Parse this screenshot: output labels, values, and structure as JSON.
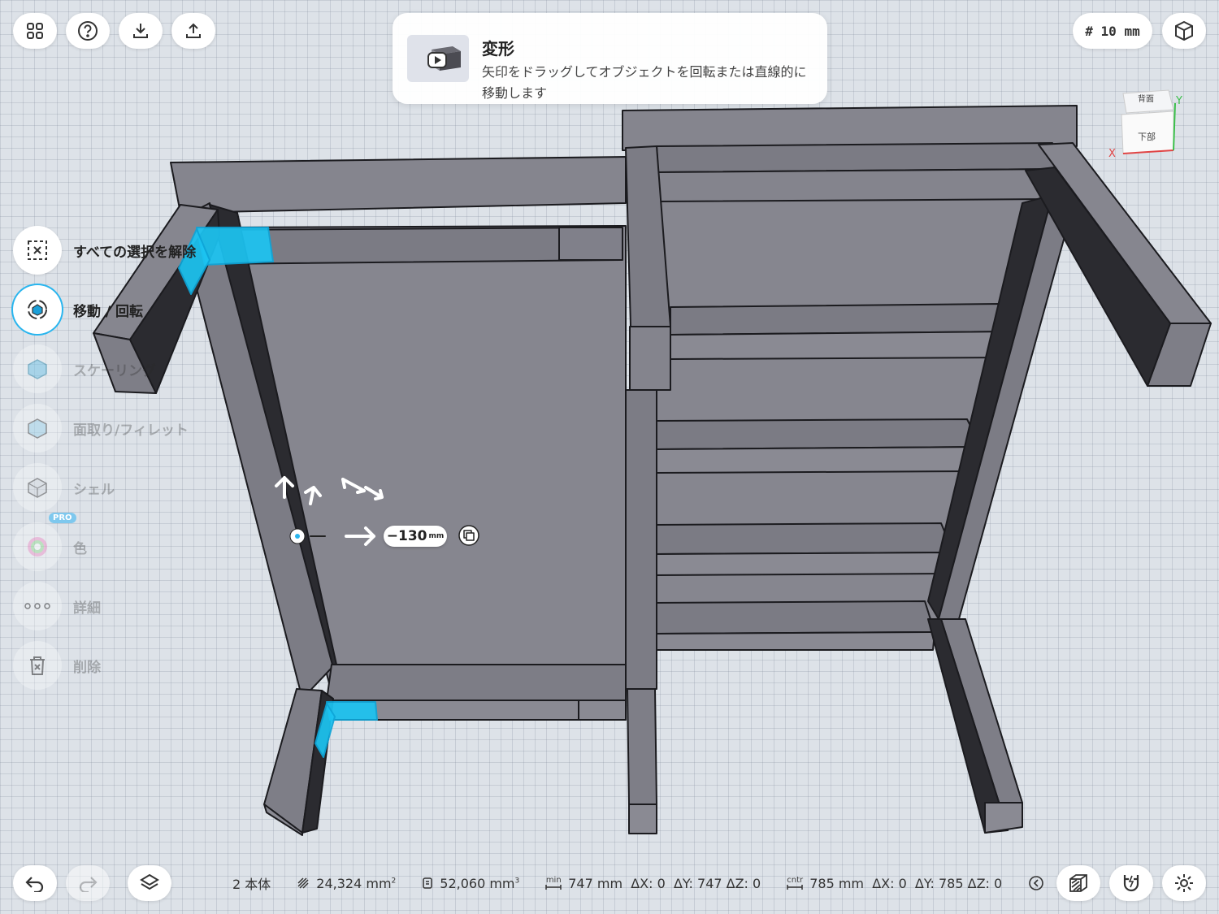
{
  "toolbar": {
    "grid_label": "# 10 mm"
  },
  "toast": {
    "title": "変形",
    "body": "矢印をドラッグしてオブジェクトを回転または直線的に移動します"
  },
  "view_cube": {
    "top_face": "背面",
    "front_face": "下部",
    "axis_x": "X",
    "axis_y": "Y"
  },
  "menu": {
    "items": [
      {
        "label": "すべての選択を解除"
      },
      {
        "label": "移動 / 回転"
      },
      {
        "label": "スケーリング"
      },
      {
        "label": "面取り/フィレット"
      },
      {
        "label": "シェル"
      },
      {
        "label": "色",
        "badge": "PRO"
      },
      {
        "label": "詳細"
      },
      {
        "label": "削除"
      }
    ]
  },
  "gizmo": {
    "value": "−130",
    "unit": "mm"
  },
  "status": {
    "bodies": "2 本体",
    "area": "24,324 mm",
    "area_exp": "2",
    "volume": "52,060 mm",
    "volume_exp": "3",
    "min_label": "min",
    "min_text": "747 mm  ΔX: 0  ΔY: 747 ΔZ: 0",
    "cntr_label": "cntr",
    "cntr_text": "785 mm  ΔX: 0  ΔY: 785 ΔZ: 0"
  },
  "colors": {
    "selection": "#1cc4f2",
    "body_gray": "#7f7f88",
    "accent_ring": "#29b5ee"
  }
}
